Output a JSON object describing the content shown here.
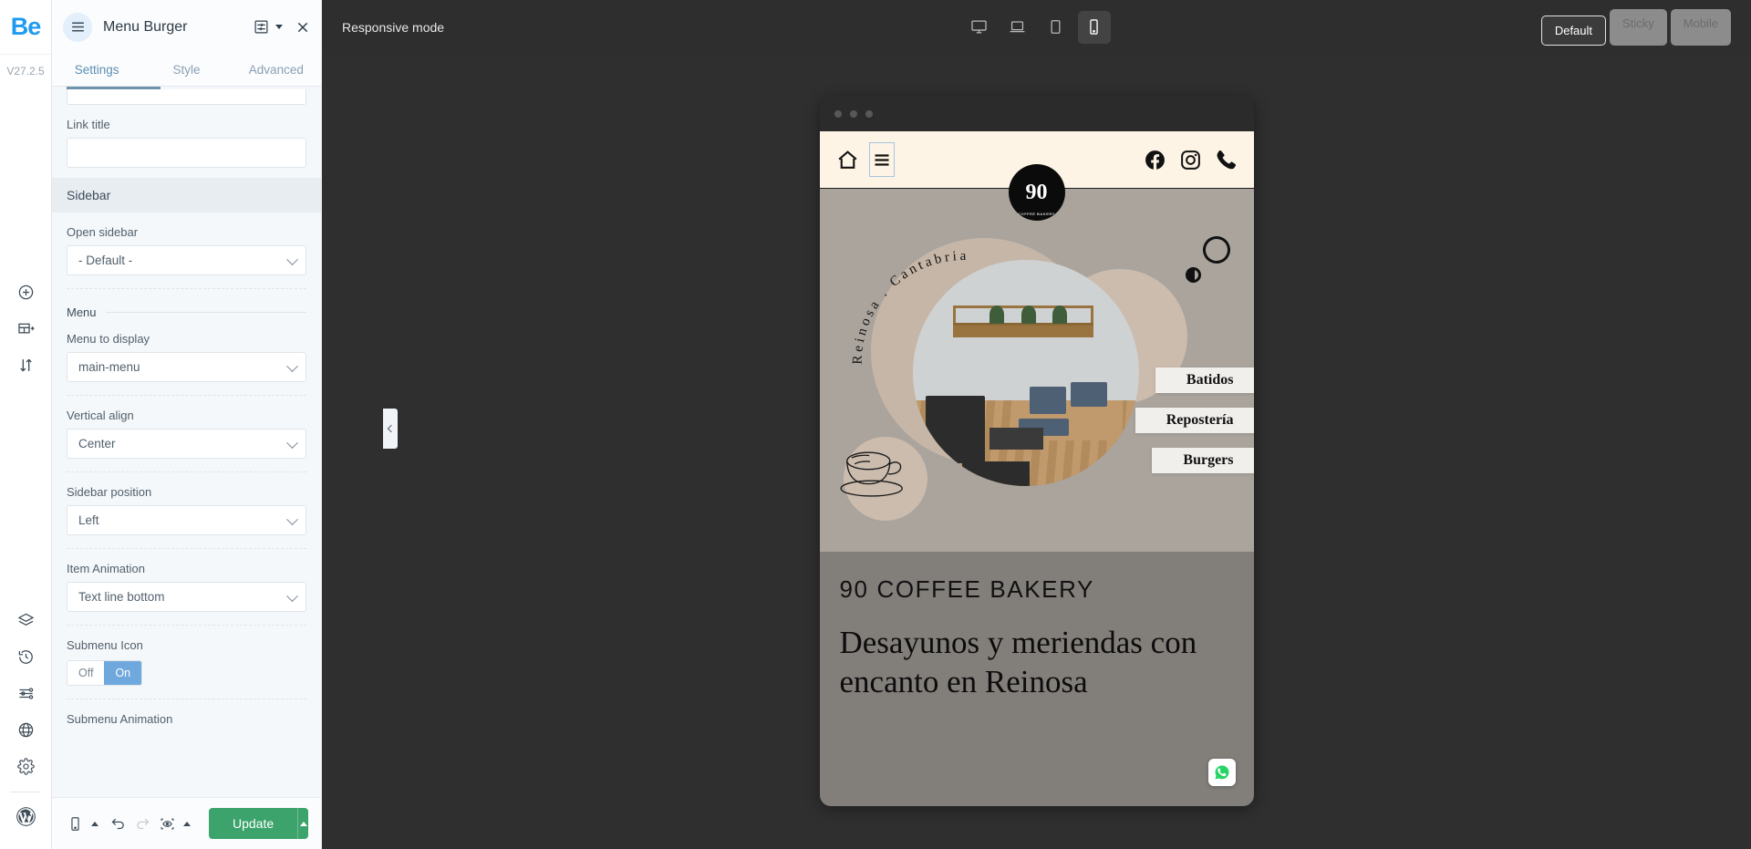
{
  "rail": {
    "logo": "Be",
    "version": "V27.2.5",
    "top_icons": [
      {
        "name": "add-element-icon",
        "label": "Add element"
      },
      {
        "name": "add-section-icon",
        "label": "Add section"
      },
      {
        "name": "reorder-icon",
        "label": "Reorder"
      }
    ],
    "bottom_icons": [
      {
        "name": "layers-icon",
        "label": "Layers"
      },
      {
        "name": "history-icon",
        "label": "History"
      },
      {
        "name": "options-icon",
        "label": "Options"
      },
      {
        "name": "globe-icon",
        "label": "Global"
      },
      {
        "name": "gear-icon",
        "label": "Settings"
      }
    ],
    "wordpress_icon": "wordpress-icon"
  },
  "panel": {
    "title": "Menu Burger",
    "burger_icon": "hamburger-icon",
    "settings_icon": "element-settings-icon",
    "caret_icon": "chevron-down-icon",
    "close_icon": "close-icon",
    "tabs": [
      {
        "label": "Settings",
        "active": true
      },
      {
        "label": "Style",
        "active": false
      },
      {
        "label": "Advanced",
        "active": false
      }
    ],
    "fields": {
      "link_title_label": "Link title",
      "link_title_value": "",
      "link_title_placeholder": ""
    },
    "sections": {
      "sidebar_header": "Sidebar",
      "menu_header": "Menu"
    },
    "controls": [
      {
        "label": "Open sidebar",
        "value": "- Default -",
        "type": "select"
      },
      {
        "label": "Menu to display",
        "value": "main-menu",
        "type": "select"
      },
      {
        "label": "Vertical align",
        "value": "Center",
        "type": "select"
      },
      {
        "label": "Sidebar position",
        "value": "Left",
        "type": "select"
      },
      {
        "label": "Item Animation",
        "value": "Text line bottom",
        "type": "select"
      }
    ],
    "submenu_icon": {
      "label": "Submenu Icon",
      "off_label": "Off",
      "on_label": "On",
      "selected": "On"
    },
    "submenu_animation_label": "Submenu Animation",
    "footer": {
      "device_icon": "mobile-preview-icon",
      "device_caret": "caret-up-icon",
      "undo_icon": "undo-icon",
      "redo_icon": "redo-icon",
      "preview_icon": "preview-eye-icon",
      "preview_caret": "caret-up-icon",
      "update_label": "Update",
      "update_caret": "caret-up-icon",
      "update_color": "#3ba36b"
    },
    "collapse_icon": "chevron-left-icon"
  },
  "topbar": {
    "mode_label": "Responsive mode",
    "devices": [
      {
        "name": "desktop-icon",
        "label": "Desktop",
        "active": false
      },
      {
        "name": "laptop-icon",
        "label": "Laptop",
        "active": false
      },
      {
        "name": "tablet-icon",
        "label": "Tablet",
        "active": false
      },
      {
        "name": "mobile-icon",
        "label": "Mobile",
        "active": true
      }
    ],
    "states": [
      {
        "label": "Default",
        "active": true
      },
      {
        "label": "Sticky",
        "active": false
      },
      {
        "label": "Mobile",
        "active": false
      }
    ]
  },
  "preview": {
    "site_header": {
      "home_icon": "home-icon",
      "burger_icon": "hamburger-icon",
      "facebook_icon": "facebook-icon",
      "instagram_icon": "instagram-icon",
      "phone_icon": "phone-icon",
      "logo_number": "90",
      "logo_sub": "COFFEE BAKERY"
    },
    "hero": {
      "arc_text": "Reinosa . Cantabria",
      "tags": [
        "Batidos",
        "Repostería",
        "Burgers"
      ],
      "cup_icon": "coffee-cup-icon",
      "ring_big_icon": "coffee-ring-icon",
      "ring_small_icon": "coffee-ring-small-icon"
    },
    "caption": {
      "kicker": "90 COFFEE BAKERY",
      "headline": "Desayunos y meriendas con encanto en Reinosa"
    },
    "whatsapp_icon": "whatsapp-icon",
    "whatsapp_color": "#25d366"
  }
}
